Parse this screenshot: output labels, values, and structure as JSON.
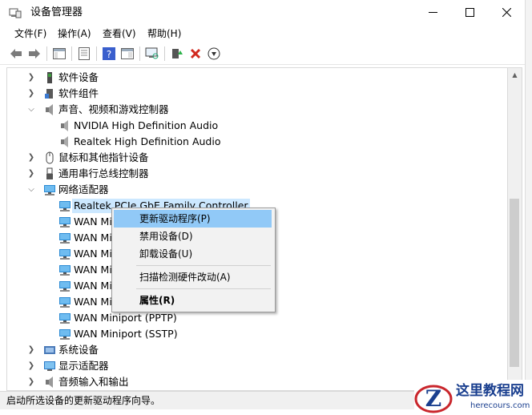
{
  "window": {
    "title": "设备管理器",
    "minimize_icon": "minimize-icon",
    "maximize_icon": "maximize-icon",
    "close_icon": "close-icon"
  },
  "menu": [
    "文件(F)",
    "操作(A)",
    "查看(V)",
    "帮助(H)"
  ],
  "toolbar": [
    "back-arrow-icon",
    "forward-arrow-icon",
    "show-hide-tree-icon",
    "properties-sheet-icon",
    "help-icon",
    "view-icon",
    "scan-hardware-icon",
    "update-driver-icon",
    "uninstall-x-icon",
    "download-icon"
  ],
  "tree": [
    {
      "label": "软件设备",
      "icon": "software-device-icon"
    },
    {
      "label": "软件组件",
      "icon": "software-component-icon"
    },
    {
      "label": "声音、视频和游戏控制器",
      "icon": "speaker-icon"
    },
    {
      "label": "NVIDIA High Definition Audio",
      "icon": "speaker-icon"
    },
    {
      "label": "Realtek High Definition Audio",
      "icon": "speaker-icon"
    },
    {
      "label": "鼠标和其他指针设备",
      "icon": "mouse-icon"
    },
    {
      "label": "通用串行总线控制器",
      "icon": "usb-icon"
    },
    {
      "label": "网络适配器",
      "icon": "network-adapter-icon"
    },
    {
      "label": "Realtek PCIe GbE Family Controller",
      "icon": "network-adapter-icon"
    },
    {
      "label": "WAN Mi",
      "icon": "network-adapter-icon"
    },
    {
      "label": "WAN Mi",
      "icon": "network-adapter-icon"
    },
    {
      "label": "WAN Mi",
      "icon": "network-adapter-icon"
    },
    {
      "label": "WAN Mi",
      "icon": "network-adapter-icon"
    },
    {
      "label": "WAN Mi",
      "icon": "network-adapter-icon"
    },
    {
      "label": "WAN Mi",
      "icon": "network-adapter-icon"
    },
    {
      "label": "WAN Miniport (PPTP)",
      "icon": "network-adapter-icon"
    },
    {
      "label": "WAN Miniport (SSTP)",
      "icon": "network-adapter-icon"
    },
    {
      "label": "系统设备",
      "icon": "system-device-icon"
    },
    {
      "label": "显示适配器",
      "icon": "display-adapter-icon"
    },
    {
      "label": "音频输入和输出",
      "icon": "audio-io-icon"
    }
  ],
  "context_menu": {
    "update_driver": "更新驱动程序(P)",
    "disable_device": "禁用设备(D)",
    "uninstall_device": "卸载设备(U)",
    "scan_changes": "扫描检测硬件改动(A)",
    "properties": "属性(R)"
  },
  "status": "启动所选设备的更新驱动程序向导。",
  "watermark": {
    "title": "这里教程网",
    "url": "herecours.com"
  },
  "colors": {
    "selection": "#cce8ff",
    "menu_highlight": "#91c9f7",
    "network_icon": "#2a8ad4"
  }
}
